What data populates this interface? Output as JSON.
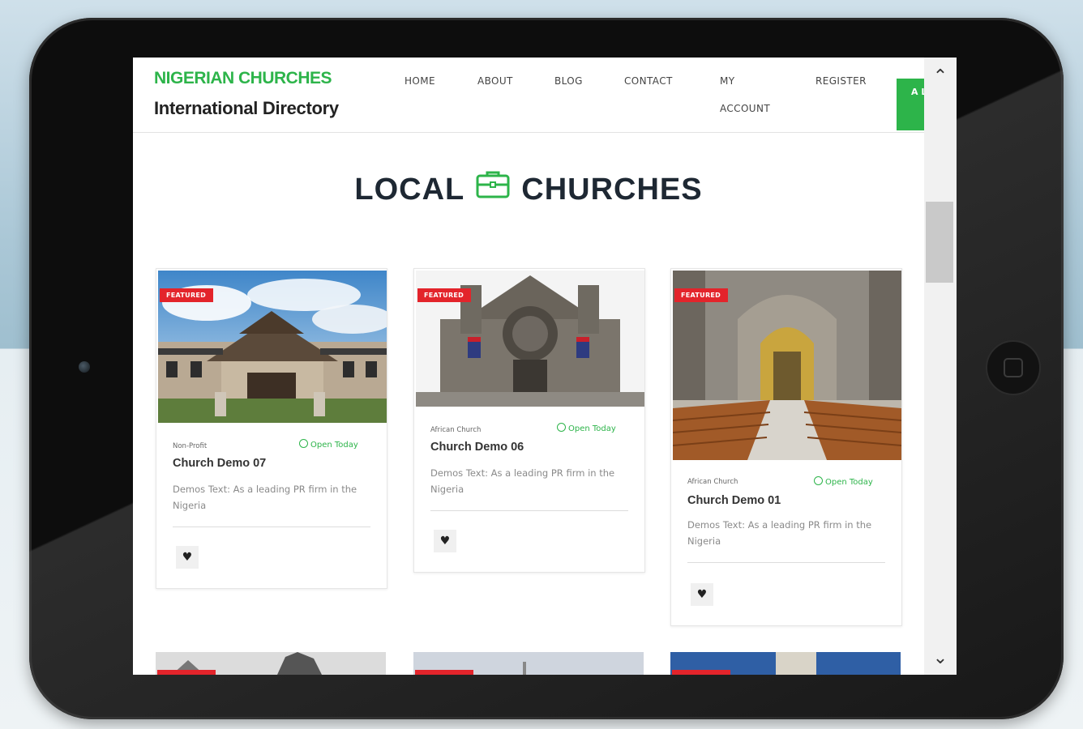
{
  "brand": {
    "line1": "NIGERIAN CHURCHES",
    "line2": "International Directory"
  },
  "nav": {
    "home": "HOME",
    "about": "ABOUT",
    "blog": "BLOG",
    "contact": "CONTACT",
    "my": "MY",
    "account": "ACCOUNT",
    "register": "REGISTER",
    "add_listing": "A LI"
  },
  "section": {
    "title_left": "LOCAL",
    "title_right": "CHURCHES",
    "icon": "briefcase-icon"
  },
  "colors": {
    "accent": "#2db44a",
    "featured": "#e3242b",
    "title": "#1e2833"
  },
  "cards": [
    {
      "badge": "FEATURED",
      "category": "Non-Profit",
      "status": "Open Today",
      "title": "Church Demo 07",
      "desc": "Demos Text: As a leading PR firm in the Nigeria"
    },
    {
      "badge": "FEATURED",
      "category": "African Church",
      "status": "Open Today",
      "title": "Church Demo 06",
      "desc": "Demos Text: As a leading PR firm in the Nigeria"
    },
    {
      "badge": "FEATURED",
      "category": "African Church",
      "status": "Open Today",
      "title": "Church Demo 01",
      "desc": "Demos Text: As a leading PR firm in the Nigeria"
    }
  ]
}
